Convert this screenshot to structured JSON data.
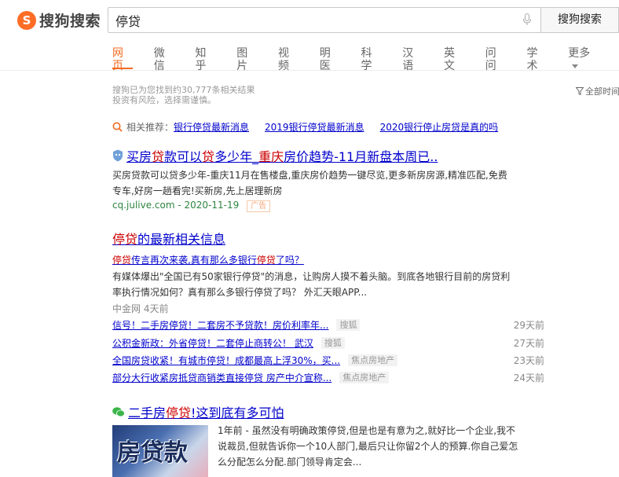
{
  "header": {
    "logo_text": "搜狗搜索",
    "search_value": "停贷",
    "search_button": "搜狗搜索"
  },
  "tabs": [
    {
      "label": "网页",
      "active": true
    },
    {
      "label": "微信"
    },
    {
      "label": "知乎"
    },
    {
      "label": "图片"
    },
    {
      "label": "视频"
    },
    {
      "label": "明医"
    },
    {
      "label": "科学"
    },
    {
      "label": "汉语"
    },
    {
      "label": "英文"
    },
    {
      "label": "问问"
    },
    {
      "label": "学术"
    },
    {
      "label": "更多"
    }
  ],
  "result_info": {
    "count_text": "搜狗已为您找到约30,777条相关结果",
    "risk_text": "投资有风险，选择需谨慎。",
    "filter_label": "全部时间"
  },
  "related": {
    "label": "相关推荐：",
    "links": [
      "银行停贷最新消息",
      "2019银行停贷最新消息",
      "2020银行停止房贷是真的吗"
    ]
  },
  "ad": {
    "title_a": "买房",
    "title_b": "贷",
    "title_c": "款可以",
    "title_d": "贷",
    "title_e": "多少年_",
    "title_f": "重庆",
    "title_g": "房价趋势-11月新盘本周已..",
    "desc_line1": "买房贷款可以贷多少年-重庆11月在售楼盘,重庆房价趋势一键尽览,更多新房房源,精准匹配,免费",
    "desc_line2": "专车,好房一趟看完!买新房,先上居理新房",
    "source": "cq.julive.com - 2020-11-19",
    "ad_tag": "广告"
  },
  "news": {
    "title_kw": "停贷",
    "title_rest": "的最新相关信息",
    "sub_a": "停贷",
    "sub_b": "传言再次来袭,真有那么多银行",
    "sub_c": "停贷",
    "sub_d": "了吗？",
    "desc_line1": "有媒体爆出\"全国已有50家银行停贷\"的消息，让购房人摸不着头脑。到底各地银行目前的房贷利",
    "desc_line2": "率执行情况如何？真有那么多银行停贷了吗？ 外汇天眼APP...",
    "meta": "中金网  4天前",
    "items": [
      {
        "title": "信号！二手房停贷！二套房不予贷款！房价利率年...",
        "source": "搜狐",
        "time": "29天前"
      },
      {
        "title": "公积金新政：外省停贷！二套停止商转公！ 武汉",
        "source": "搜狐",
        "time": "27天前"
      },
      {
        "title": "全国房贷收紧！有城市停贷！成都最高上浮30%，买...",
        "source": "焦点房地产",
        "time": "23天前"
      },
      {
        "title": "部分大行收紧房抵贷商销类直接停贷 房产中介宣称...",
        "source": "焦点房地产",
        "time": "24天前"
      }
    ]
  },
  "wechat": {
    "title_a": "二手房",
    "title_b": "停贷",
    "title_c": "!这到底有多可怕",
    "thumb_text": "房贷款",
    "desc_line1": "1年前 -  虽然没有明确政策停贷,但是也是有意为之,就好比一个企业,我不",
    "desc_line2": "说裁员,但就告诉你一个10人部门,最后只让你留2个人的预算.你自己爱怎",
    "desc_line3": "么分配怎么分配.部门领导肯定会..."
  },
  "colors": {
    "accent": "#f26b21",
    "link": "#0000cc",
    "keyword": "#cc0000",
    "source_green": "#2e8540"
  }
}
